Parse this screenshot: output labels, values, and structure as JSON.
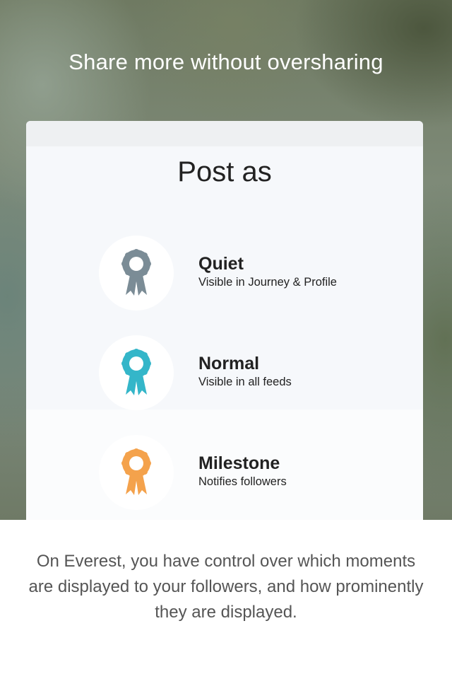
{
  "headline": "Share more without oversharing",
  "card": {
    "title": "Post as",
    "options": [
      {
        "label": "Quiet",
        "description": "Visible in Journey & Profile",
        "icon": "ribbon-icon",
        "color": "#7b8c96"
      },
      {
        "label": "Normal",
        "description": "Visible in all feeds",
        "icon": "ribbon-icon",
        "color": "#34b6c9"
      },
      {
        "label": "Milestone",
        "description": "Notifies followers",
        "icon": "ribbon-icon",
        "color": "#f4a24c"
      }
    ]
  },
  "footer_text": "On Everest, you have control over which moments are displayed to your followers, and how prominently they are displayed."
}
